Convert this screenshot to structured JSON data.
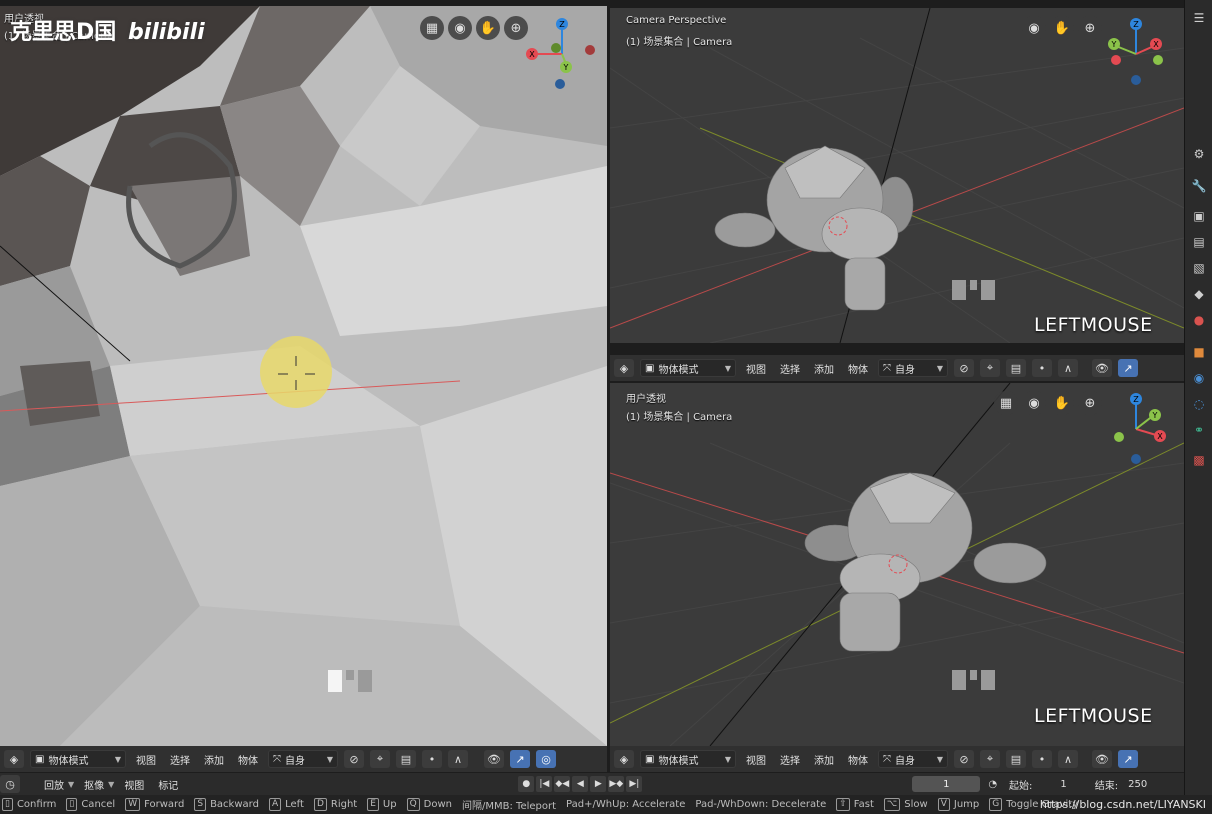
{
  "watermark": {
    "text": "克里思D国",
    "brand": "bilibili"
  },
  "left_viewport": {
    "label_line1": "用户透视",
    "label_line2": "(1) 场景集合 | Camera",
    "header": {
      "mode": "物体模式",
      "menus": [
        "视图",
        "选择",
        "添加",
        "物体"
      ],
      "transform": "自身"
    }
  },
  "top_right_viewport": {
    "label_line1": "Camera Perspective",
    "label_line2": "(1) 场景集合 | Camera",
    "key_overlay": "LEFTMOUSE",
    "header": {
      "mode": "物体模式",
      "menus": [
        "视图",
        "选择",
        "添加",
        "物体"
      ],
      "transform": "自身"
    }
  },
  "bottom_right_viewport": {
    "label_line1": "用户透视",
    "label_line2": "(1) 场景集合 | Camera",
    "key_overlay": "LEFTMOUSE",
    "header": {
      "mode": "物体模式",
      "menus": [
        "视图",
        "选择",
        "添加",
        "物体"
      ],
      "transform": "自身"
    }
  },
  "gizmo": {
    "z": "Z",
    "y": "Y",
    "x": "X"
  },
  "timeline": {
    "playback": "回放",
    "keying": "抠像",
    "view": "视图",
    "marker": "标记",
    "current_frame": "1",
    "start_label": "起始:",
    "start": "1",
    "end_label": "结束:",
    "end": "250"
  },
  "status_bar": [
    {
      "key": "",
      "label": "Confirm"
    },
    {
      "key": "",
      "label": "Cancel"
    },
    {
      "key": "W",
      "label": "Forward"
    },
    {
      "key": "S",
      "label": "Backward"
    },
    {
      "key": "A",
      "label": "Left"
    },
    {
      "key": "D",
      "label": "Right"
    },
    {
      "key": "E",
      "label": "Up"
    },
    {
      "key": "Q",
      "label": "Down"
    },
    {
      "key": "",
      "label": "间隔/MMB: Teleport"
    },
    {
      "key": "",
      "label": "Pad+/WhUp: Accelerate"
    },
    {
      "key": "",
      "label": "Pad-/WhDown: Decelerate"
    },
    {
      "key": "⇧",
      "label": "Fast"
    },
    {
      "key": "⌥",
      "label": "Slow"
    },
    {
      "key": "V",
      "label": "Jump"
    },
    {
      "key": "G",
      "label": "Toggle Gravity"
    }
  ],
  "url_watermark": "https://blog.csdn.net/LIYANSKI",
  "colors": {
    "accent_blue": "#4772b3",
    "axis_x": "#e44a52",
    "axis_y": "#8bc34a",
    "axis_z": "#2e86de",
    "viewport_bg": "#3d3d3d",
    "click_highlight": "#e8d86a"
  }
}
